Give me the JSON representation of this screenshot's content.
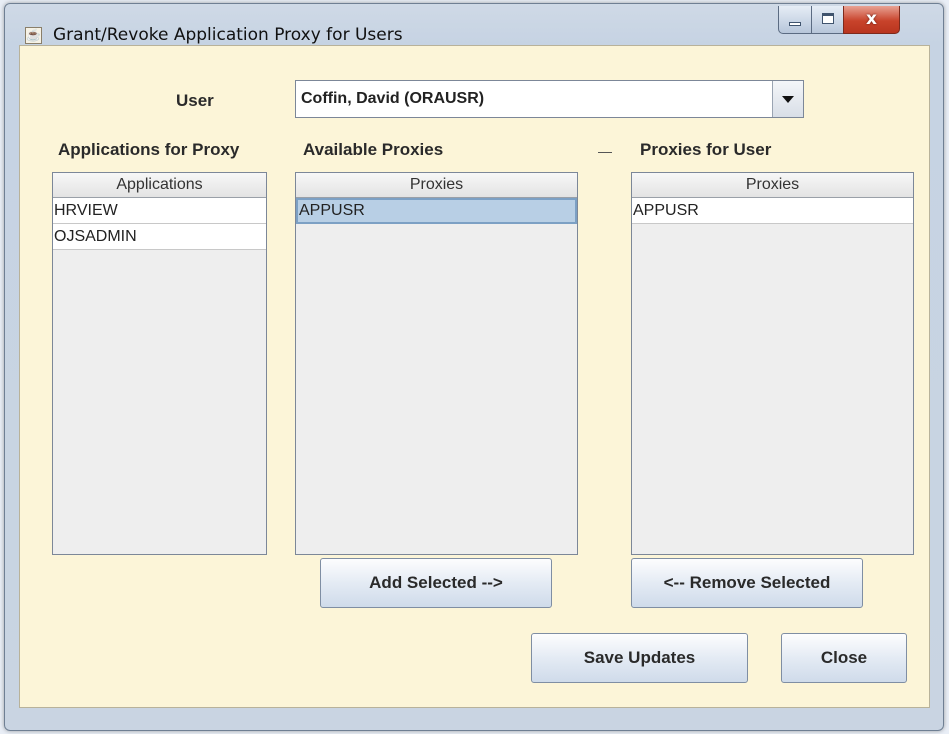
{
  "window": {
    "title": "Grant/Revoke Application Proxy for Users",
    "close_glyph": "x"
  },
  "user": {
    "label": "User",
    "selected": "Coffin, David (ORAUSR)"
  },
  "applications": {
    "section_label": "Applications for Proxy",
    "header": "Applications",
    "items": [
      "HRVIEW",
      "OJSADMIN"
    ]
  },
  "available": {
    "section_label": "Available Proxies",
    "header": "Proxies",
    "items": [
      "APPUSR"
    ]
  },
  "user_proxies": {
    "section_label": "Proxies for User",
    "header": "Proxies",
    "items": [
      "APPUSR"
    ]
  },
  "buttons": {
    "add": "Add Selected -->",
    "remove": "<-- Remove Selected",
    "save": "Save Updates",
    "close": "Close"
  }
}
